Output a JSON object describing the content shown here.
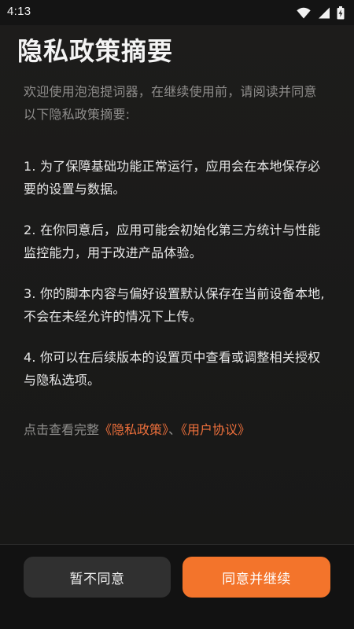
{
  "status_bar": {
    "time": "4:13",
    "icons": [
      "wifi-icon",
      "signal-icon",
      "battery-icon"
    ]
  },
  "title": "隐私政策摘要",
  "intro": "欢迎使用泡泡提词器，在继续使用前，请阅读并同意以下隐私政策摘要:",
  "terms": [
    "1. 为了保障基础功能正常运行，应用会在本地保存必要的设置与数据。",
    "2. 在你同意后，应用可能会初始化第三方统计与性能监控能力，用于改进产品体验。",
    "3. 你的脚本内容与偏好设置默认保存在当前设备本地,不会在未经允许的情况下上传。",
    "4. 你可以在后续版本的设置页中查看或调整相关授权与隐私选项。"
  ],
  "links": {
    "prefix": "点击查看完整",
    "privacy_policy": "《隐私政策》",
    "separator": "、",
    "user_agreement": "《用户协议》"
  },
  "buttons": {
    "decline": "暂不同意",
    "agree": "同意并继续"
  },
  "colors": {
    "accent": "#f3742b",
    "link": "#ec6f3b",
    "background": "#1a1a19"
  }
}
